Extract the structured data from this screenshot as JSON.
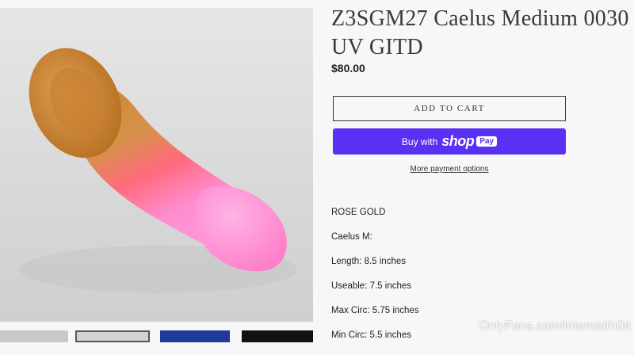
{
  "product": {
    "title": "Z3SGM27 Caelus Medium 0030 UV GITD",
    "price": "$80.00"
  },
  "buttons": {
    "add_to_cart": "ADD TO CART",
    "shop_pay_prefix": "Buy with",
    "shop_pay_brand": "shop",
    "shop_pay_badge": "Pay",
    "more_payment": "More payment options"
  },
  "description": [
    "ROSE GOLD",
    "Caelus M:",
    "Length: 8.5 inches",
    "Useable: 7.5 inches",
    "Max Circ: 5.75 inches",
    "Min Circ: 5.5 inches"
  ],
  "watermark": "OnlyFans.com/internetth0tt",
  "colors": {
    "accent_shop": "#5a31f4",
    "text": "#222222"
  }
}
